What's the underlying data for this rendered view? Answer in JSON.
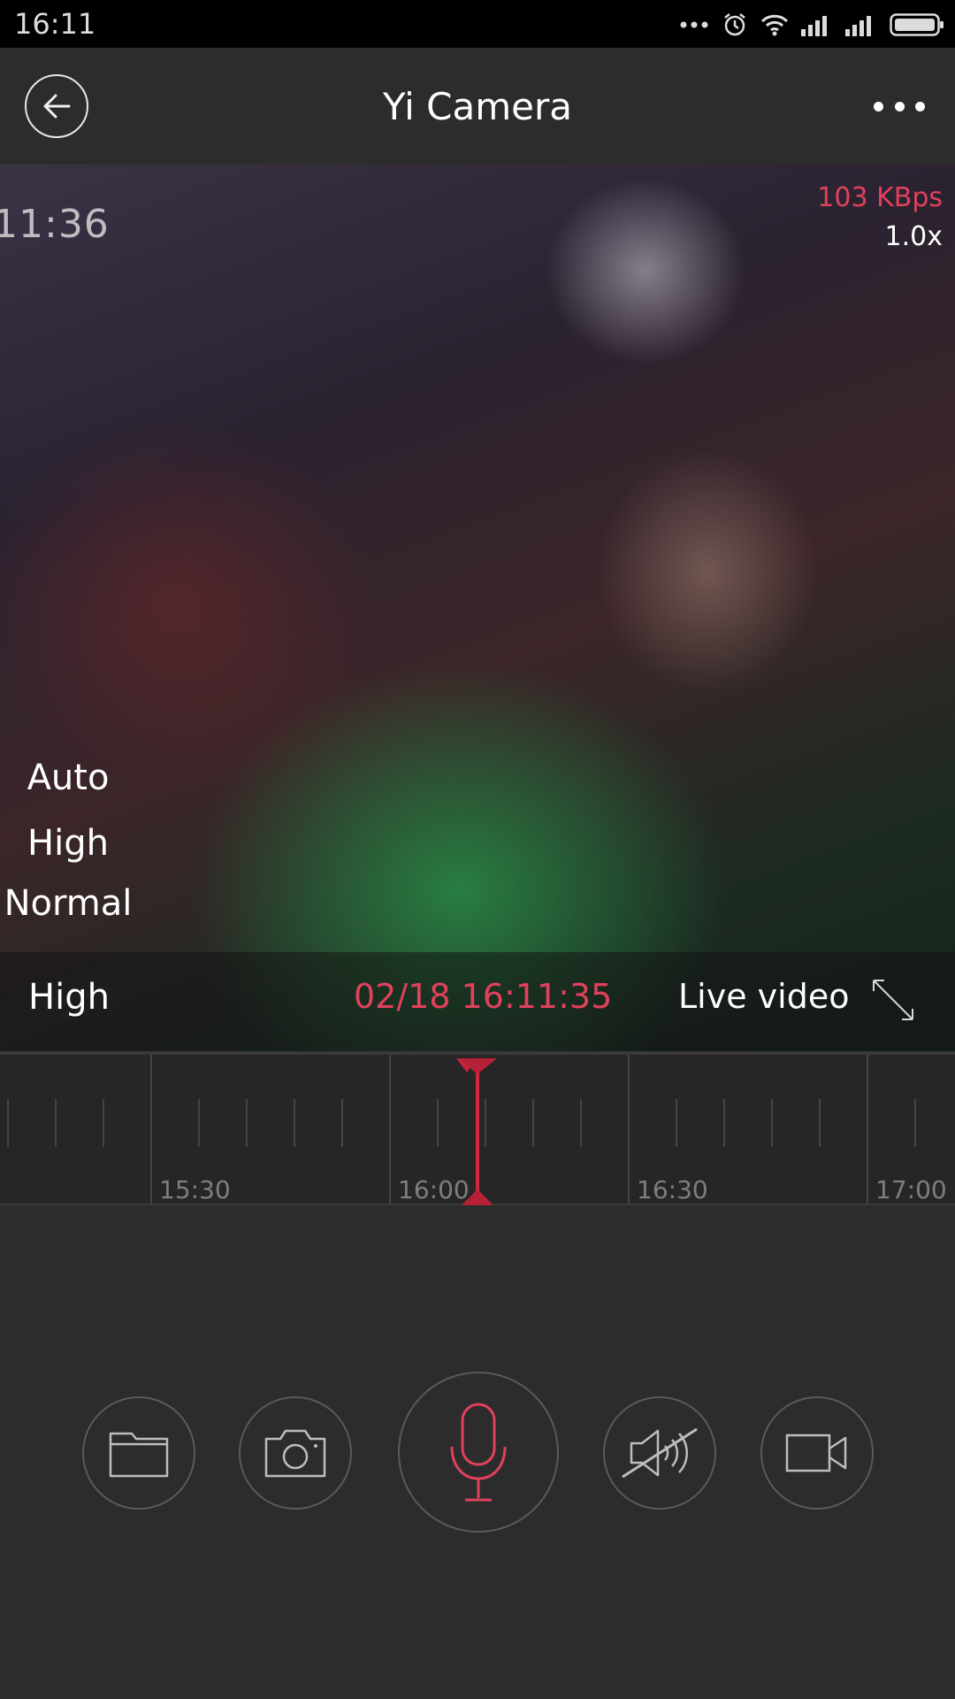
{
  "status_bar": {
    "time": "16:11",
    "icons": [
      "more-dots-icon",
      "alarm-icon",
      "wifi-icon",
      "signal-icon",
      "signal-icon",
      "battery-icon"
    ]
  },
  "app_bar": {
    "title": "Yi Camera",
    "back_icon": "back-arrow-icon",
    "menu_icon": "more-horizontal-icon"
  },
  "video": {
    "camera_overlay_time": "11:36",
    "bitrate": "103 KBps",
    "zoom": "1.0x",
    "quality_menu": [
      "Auto",
      "High",
      "Normal"
    ],
    "current_quality": "High",
    "timestamp": "02/18 16:11:35",
    "mode": "Live video"
  },
  "timeline": {
    "labels": [
      "15:30",
      "16:00",
      "16:30",
      "17:00"
    ]
  },
  "controls": {
    "buttons": [
      "folder-icon",
      "camera-icon",
      "microphone-icon",
      "speaker-muted-icon",
      "video-record-icon"
    ]
  },
  "colors": {
    "accent": "#e0415c",
    "background": "#2c2c2c"
  }
}
